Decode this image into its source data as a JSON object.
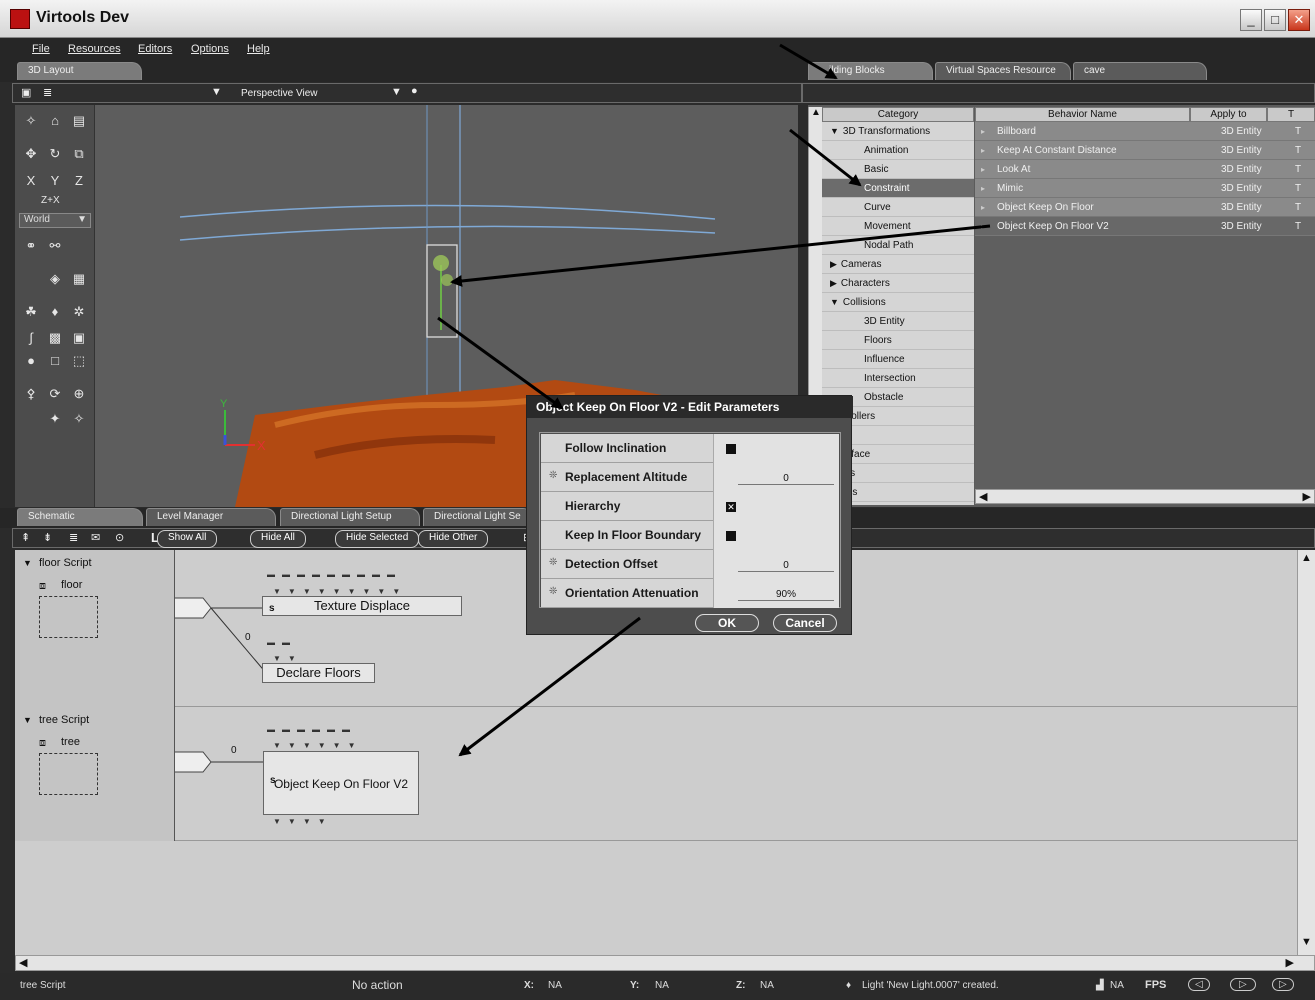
{
  "window": {
    "title": "Virtools Dev",
    "minimize": "_",
    "maximize": "□",
    "close": "✕"
  },
  "menu": [
    "File",
    "Resources",
    "Editors",
    "Options",
    "Help"
  ],
  "top_tabs": {
    "layout": "3D Layout",
    "building_blocks": "ilding Blocks",
    "virtual_spaces": "Virtual Spaces Resource",
    "cave": "cave"
  },
  "view_toolbar": {
    "view_select": "Perspective View"
  },
  "toolbox": {
    "axes_label": "Z+X",
    "world_select": "World"
  },
  "bb_table": {
    "headers": {
      "category": "Category",
      "behavior": "Behavior Name",
      "apply_to": "Apply to",
      "t": "T"
    },
    "categories": [
      {
        "label": "3D Transformations",
        "indent": 0,
        "expander": "▼",
        "selected": false
      },
      {
        "label": "Animation",
        "indent": 1,
        "expander": "",
        "selected": false
      },
      {
        "label": "Basic",
        "indent": 1,
        "expander": "",
        "selected": false
      },
      {
        "label": "Constraint",
        "indent": 1,
        "expander": "",
        "selected": true
      },
      {
        "label": "Curve",
        "indent": 1,
        "expander": "",
        "selected": false
      },
      {
        "label": "Movement",
        "indent": 1,
        "expander": "",
        "selected": false
      },
      {
        "label": "Nodal Path",
        "indent": 1,
        "expander": "",
        "selected": false
      },
      {
        "label": "Cameras",
        "indent": 0,
        "expander": "▶",
        "selected": false
      },
      {
        "label": "Characters",
        "indent": 0,
        "expander": "▶",
        "selected": false
      },
      {
        "label": "Collisions",
        "indent": 0,
        "expander": "▼",
        "selected": false
      },
      {
        "label": "3D Entity",
        "indent": 1,
        "expander": "",
        "selected": false
      },
      {
        "label": "Floors",
        "indent": 1,
        "expander": "",
        "selected": false
      },
      {
        "label": "Influence",
        "indent": 1,
        "expander": "",
        "selected": false
      },
      {
        "label": "Intersection",
        "indent": 1,
        "expander": "",
        "selected": false
      },
      {
        "label": "Obstacle",
        "indent": 1,
        "expander": "",
        "selected": false
      },
      {
        "label": "ontrollers",
        "indent": 0,
        "expander": "",
        "selected": false
      },
      {
        "label": "rids",
        "indent": 0,
        "expander": "",
        "selected": false
      },
      {
        "label": "nterface",
        "indent": 0,
        "expander": "",
        "selected": false
      },
      {
        "label": "ights",
        "indent": 0,
        "expander": "",
        "selected": false
      },
      {
        "label": "ogics",
        "indent": 0,
        "expander": "",
        "selected": false
      }
    ],
    "behaviors": [
      {
        "name": "Billboard",
        "apply": "3D Entity",
        "t": "T",
        "selected": false
      },
      {
        "name": "Keep At Constant Distance",
        "apply": "3D Entity",
        "t": "T",
        "selected": false
      },
      {
        "name": "Look At",
        "apply": "3D Entity",
        "t": "T",
        "selected": false
      },
      {
        "name": "Mimic",
        "apply": "3D Entity",
        "t": "T",
        "selected": false
      },
      {
        "name": "Object Keep On Floor",
        "apply": "3D Entity",
        "t": "T",
        "selected": false
      },
      {
        "name": "Object Keep On Floor V2",
        "apply": "3D Entity",
        "t": "T",
        "selected": true
      }
    ]
  },
  "bottom_tabs": {
    "schematic": "Schematic",
    "level_manager": "Level Manager",
    "dir_light_setup": "Directional Light Setup",
    "dir_light_se": "Directional Light Se"
  },
  "schematic_toolbar": {
    "letter_l": "L",
    "show_all": "Show All",
    "hide_all": "Hide All",
    "hide_selected": "Hide Selected",
    "hide_other": "Hide Other"
  },
  "scripts": {
    "floor": {
      "title": "floor Script",
      "object": "floor",
      "texture_bb": "Texture Displace",
      "declare_bb": "Declare Floors",
      "link_value": "0",
      "s_marker": "s"
    },
    "tree": {
      "title": "tree Script",
      "object": "tree",
      "keep_bb": "Object Keep On Floor V2",
      "link_value": "0",
      "s_marker": "s"
    }
  },
  "dialog": {
    "title": "Object Keep On Floor V2 - Edit Parameters",
    "params": [
      {
        "label": "Follow Inclination",
        "kind": "check",
        "value": "",
        "gear": false
      },
      {
        "label": "Replacement Altitude",
        "kind": "value",
        "value": "0",
        "gear": true
      },
      {
        "label": "Hierarchy",
        "kind": "check-x",
        "value": "",
        "gear": false
      },
      {
        "label": "Keep In Floor Boundary",
        "kind": "check",
        "value": "",
        "gear": false
      },
      {
        "label": "Detection Offset",
        "kind": "value",
        "value": "0",
        "gear": true
      },
      {
        "label": "Orientation Attenuation",
        "kind": "value",
        "value": "90%",
        "gear": true
      }
    ],
    "ok": "OK",
    "cancel": "Cancel"
  },
  "status": {
    "left": "tree Script",
    "action": "No action",
    "x_label": "X:",
    "x": "NA",
    "y_label": "Y:",
    "y": "NA",
    "z_label": "Z:",
    "z": "NA",
    "message": "Light 'New Light.0007' created.",
    "na": "NA",
    "fps": "FPS"
  },
  "colors": {
    "accent_dark": "#2a2a2a",
    "selection": "#686868",
    "terrain": "#b24a12"
  }
}
